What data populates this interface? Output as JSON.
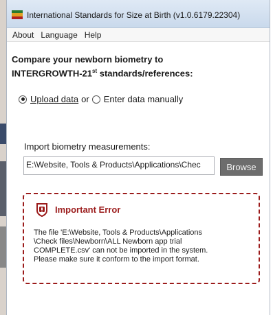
{
  "window": {
    "title": "International Standards for Size at Birth (v1.0.6179.22304)"
  },
  "menu": {
    "items": [
      "About",
      "Language",
      "Help"
    ]
  },
  "main": {
    "heading_line1": "Compare your newborn biometry to",
    "heading_line2_pre": "INTERGROWTH-21",
    "heading_line2_sup": "st",
    "heading_line2_post": " standards/references:",
    "mode": {
      "options": [
        {
          "label": "Upload data",
          "selected": true
        },
        {
          "label": "Enter data manually",
          "selected": false
        }
      ],
      "separator": "or"
    },
    "import": {
      "label": "Import biometry measurements:",
      "value": "E:\\Website, Tools & Products\\Applications\\Chec",
      "browse_label": "Browse"
    },
    "error": {
      "title": "Important Error",
      "message_lines": [
        "The file 'E:\\Website, Tools & Products\\Applications",
        "\\Check files\\Newborn\\ALL Newborn app trial",
        "COMPLETE.csv' can not be imported in the system.",
        "Please make sure it conform to the import format."
      ],
      "color": "#9b1b1b"
    }
  }
}
